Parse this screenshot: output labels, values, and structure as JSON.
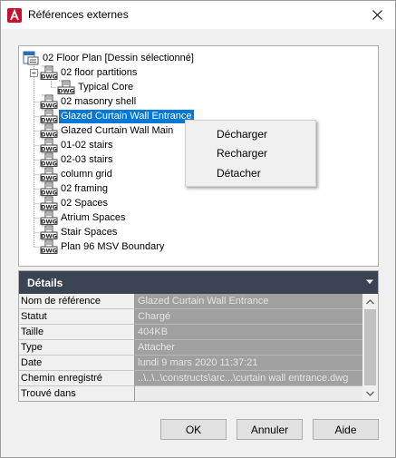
{
  "window": {
    "title": "Références externes"
  },
  "tree": {
    "root": {
      "label": "02 Floor Plan [Dessin sélectionné]"
    },
    "items": [
      {
        "label": "02 floor partitions"
      },
      {
        "label": "Typical Core"
      },
      {
        "label": "02 masonry shell"
      },
      {
        "label": "Glazed Curtain Wall Entrance",
        "selected": true
      },
      {
        "label": "Glazed Curtain Wall Main"
      },
      {
        "label": "01-02 stairs"
      },
      {
        "label": "02-03 stairs"
      },
      {
        "label": "column grid"
      },
      {
        "label": "02 framing"
      },
      {
        "label": "02 Spaces"
      },
      {
        "label": "Atrium Spaces"
      },
      {
        "label": "Stair Spaces"
      },
      {
        "label": "Plan 96 MSV Boundary"
      }
    ],
    "icon_text": "DWG"
  },
  "context_menu": {
    "items": [
      "Décharger",
      "Recharger",
      "Détacher"
    ]
  },
  "details": {
    "title": "Détails",
    "rows": [
      {
        "key": "Nom de référence",
        "value": "Glazed Curtain Wall Entrance"
      },
      {
        "key": "Statut",
        "value": "Chargé"
      },
      {
        "key": "Taille",
        "value": "404KB"
      },
      {
        "key": "Type",
        "value": "Attacher"
      },
      {
        "key": "Date",
        "value": "lundi 9 mars 2020   11:37:21"
      },
      {
        "key": "Chemin enregistré",
        "value": "..\\..\\..\\constructs\\arc...\\curtain wall entrance.dwg"
      },
      {
        "key": "Trouvé dans",
        "value": ""
      }
    ]
  },
  "buttons": {
    "ok": "OK",
    "cancel": "Annuler",
    "help": "Aide"
  },
  "colors": {
    "selection": "#0078d7",
    "details_header": "#3b4453",
    "autocad_red": "#c8102e"
  }
}
